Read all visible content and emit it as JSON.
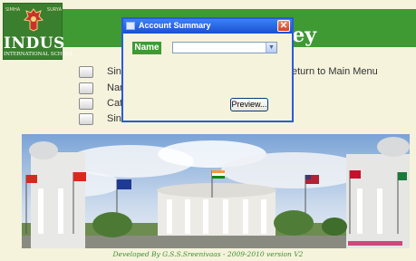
{
  "header": {
    "title_visible": "ey",
    "logo": {
      "name": "INDUS",
      "subtitle": "INTERNATIONAL SCHOOL",
      "tiny_left": "SIMHA",
      "tiny_right": "SURYA"
    }
  },
  "menu": {
    "items": [
      {
        "label": "Sinc"
      },
      {
        "label": "Nan"
      },
      {
        "label": "Cate"
      },
      {
        "label": "Sinc"
      }
    ],
    "return_label": "eturn to Main Menu"
  },
  "dialog": {
    "title": "Account Summary",
    "close_glyph": "✕",
    "name_label": "Name",
    "name_value": "",
    "preview_label": "Preview..."
  },
  "footer": {
    "text": "Developed By G.S.S.Sreenivaas - 2009-2010 version V2"
  },
  "colors": {
    "header_green": "#3f9a33",
    "background": "#f5f3dc",
    "titlebar_blue": "#1a4fd1",
    "footer_green": "#3f8f2f"
  }
}
